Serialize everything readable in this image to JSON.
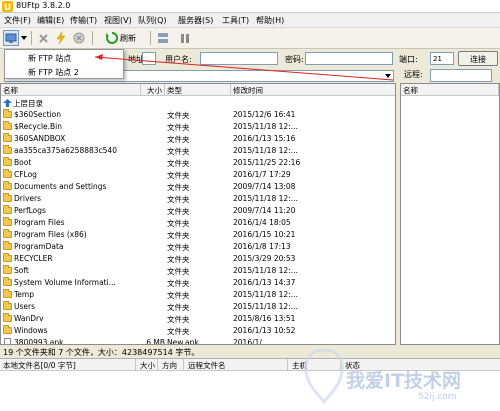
{
  "window": {
    "title": "8UFtp 3.8.2.0"
  },
  "menu": [
    "文件(F)",
    "编辑(E)",
    "传输(T)",
    "视图(V)",
    "队列(Q)",
    "服务器(S)",
    "工具(T)",
    "帮助(H)"
  ],
  "toolbar": {
    "refresh_label": "刷新"
  },
  "connection": {
    "host_label": "地址:",
    "user_label": "用户名:",
    "password_label": "密码:",
    "port_label": "端口:",
    "port_value": "21",
    "connect_button": "连接"
  },
  "dropdown": {
    "items": [
      "新 FTP 站点",
      "新 FTP 站点 2"
    ]
  },
  "remote": {
    "label": "远程:",
    "column_name": "名称"
  },
  "local": {
    "columns": [
      "名称",
      "大小",
      "类型",
      "修改时间"
    ],
    "parent_label": "上层目录",
    "rows": [
      {
        "name": "$360Section",
        "size": "",
        "type": "文件夹",
        "modified": "2015/12/6 16:41"
      },
      {
        "name": "$Recycle.Bin",
        "size": "",
        "type": "文件夹",
        "modified": "2015/11/18 12:..."
      },
      {
        "name": "360SANDBOX",
        "size": "",
        "type": "文件夹",
        "modified": "2016/1/13 15:16"
      },
      {
        "name": "aa355ca375a6258883c540",
        "size": "",
        "type": "文件夹",
        "modified": "2015/11/18 12:..."
      },
      {
        "name": "Boot",
        "size": "",
        "type": "文件夹",
        "modified": "2015/11/25 22:16"
      },
      {
        "name": "CFLog",
        "size": "",
        "type": "文件夹",
        "modified": "2016/1/7 17:29"
      },
      {
        "name": "Documents and Settings",
        "size": "",
        "type": "文件夹",
        "modified": "2009/7/14 13:08"
      },
      {
        "name": "Drivers",
        "size": "",
        "type": "文件夹",
        "modified": "2015/11/18 12:..."
      },
      {
        "name": "PerfLogs",
        "size": "",
        "type": "文件夹",
        "modified": "2009/7/14 11:20"
      },
      {
        "name": "Program Files",
        "size": "",
        "type": "文件夹",
        "modified": "2016/1/4 18:05"
      },
      {
        "name": "Program Files (x86)",
        "size": "",
        "type": "文件夹",
        "modified": "2016/1/15 10:21"
      },
      {
        "name": "ProgramData",
        "size": "",
        "type": "文件夹",
        "modified": "2016/1/8 17:13"
      },
      {
        "name": "RECYCLER",
        "size": "",
        "type": "文件夹",
        "modified": "2015/3/29 20:53"
      },
      {
        "name": "Soft",
        "size": "",
        "type": "文件夹",
        "modified": "2015/11/18 12:..."
      },
      {
        "name": "System Volume Informati...",
        "size": "",
        "type": "文件夹",
        "modified": "2016/1/13 14:37"
      },
      {
        "name": "Temp",
        "size": "",
        "type": "文件夹",
        "modified": "2015/11/18 12:..."
      },
      {
        "name": "Users",
        "size": "",
        "type": "文件夹",
        "modified": "2015/11/18 12:..."
      },
      {
        "name": "WanDrv",
        "size": "",
        "type": "文件夹",
        "modified": "2015/8/16 13:51"
      },
      {
        "name": "Windows",
        "size": "",
        "type": "文件夹",
        "modified": "2016/1/13 10:52"
      },
      {
        "name": "3800993.apk",
        "size": "6 MB",
        "type": "New.apk",
        "modified": "2016/1/..."
      }
    ]
  },
  "status": {
    "text": "19 个文件夹和 7 个文件，大小：4238497514 字节。"
  },
  "queue": {
    "columns": [
      "本地文件名[0/0 字节]",
      "大小",
      "方向",
      "远程文件名",
      "主机",
      "状态"
    ]
  },
  "watermark": {
    "text": "我爱IT技术网",
    "url": "52ij.com"
  },
  "colors": {
    "folder": "#f2c94c",
    "arrow": "#e02020"
  }
}
